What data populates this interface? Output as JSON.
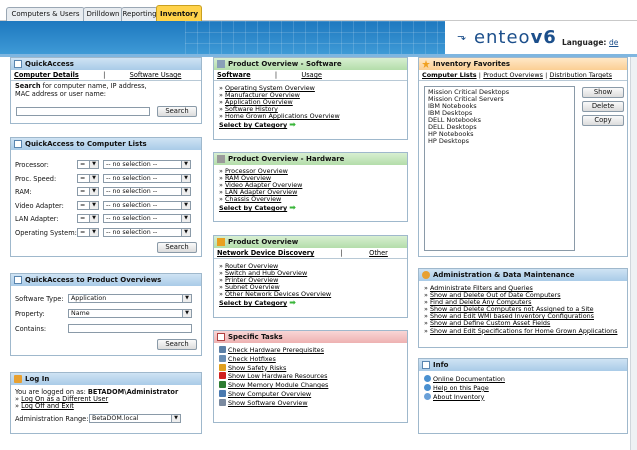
{
  "tabs": [
    {
      "label": "Computers & Users",
      "active": false
    },
    {
      "label": "Drilldown",
      "active": false
    },
    {
      "label": "Reporting",
      "active": false
    },
    {
      "label": "Inventory",
      "active": true
    }
  ],
  "header": {
    "logo_text": "enteo",
    "logo_version": "v6",
    "language_label": "Language:",
    "language_value": "de"
  },
  "quick_access": {
    "title": "QuickAccess",
    "tab_computer_details": "Computer Details",
    "separator": "|",
    "tab_software_usage": "Software Usage",
    "search_bold": "Search",
    "search_text": " for computer name, IP address,",
    "search_text2": "MAC address or user name:",
    "search_value": "",
    "search_button": "Search"
  },
  "qa_computer_lists": {
    "title": "QuickAccess to Computer Lists",
    "rows": [
      {
        "label": "Processor:",
        "op": "=",
        "value": "-- no selection --"
      },
      {
        "label": "Proc. Speed:",
        "op": "=",
        "value": "-- no selection --"
      },
      {
        "label": "RAM:",
        "op": "=",
        "value": "-- no selection --"
      },
      {
        "label": "Video Adapter:",
        "op": "=",
        "value": "-- no selection --"
      },
      {
        "label": "LAN Adapter:",
        "op": "=",
        "value": "-- no selection --"
      },
      {
        "label": "Operating System:",
        "op": "=",
        "value": "-- no selection --"
      }
    ],
    "search_button": "Search"
  },
  "qa_product_overviews": {
    "title": "QuickAccess to Product Overviews",
    "software_type_label": "Software Type:",
    "software_type_value": "Application",
    "property_label": "Property:",
    "property_value": "Name",
    "contains_label": "Contains:",
    "contains_value": "",
    "search_button": "Search"
  },
  "login": {
    "title": "Log In",
    "logged_on_text": "You are logged on as: ",
    "logged_on_user": "BETADOM\\Administrator",
    "link1": "Log On as a Different User",
    "link2": "Log Off and Exit",
    "admin_range_label": "Administration Range:",
    "admin_range_value": "BetaDOM.local"
  },
  "po_software": {
    "title": "Product Overview - Software",
    "tab1": "Software",
    "separator": "|",
    "tab2": "Usage",
    "links": [
      "Operating System Overview",
      "Manufacturer Overview",
      "Application Overview",
      "Software History",
      "Home Grown Applications Overview"
    ],
    "select_category": "Select by Category"
  },
  "po_hardware": {
    "title": "Product Overview - Hardware",
    "links": [
      "Processor Overview",
      "RAM Overview",
      "Video Adapter Overview",
      "LAN Adapter Overview",
      "Chassis Overview"
    ],
    "select_category": "Select by Category"
  },
  "product_overview": {
    "title": "Product Overview",
    "tab1": "Network Device Discovery",
    "separator": "|",
    "tab2": "Other",
    "links": [
      "Router Overview",
      "Switch and Hub Overview",
      "Printer Overview",
      "Subnet Overview",
      "Other Network Devices Overview"
    ],
    "select_category": "Select by Category"
  },
  "specific_tasks": {
    "title": "Specific Tasks",
    "items": [
      {
        "label": "Check Hardware Prerequisites",
        "icon": "hardware-icon",
        "color": "#5b7fa6"
      },
      {
        "label": "Check Hotfixes",
        "icon": "hotfix-icon",
        "color": "#6b8fb5"
      },
      {
        "label": "Show Safety Risks",
        "icon": "warning-icon",
        "color": "#e0a020"
      },
      {
        "label": "Show Low Hardware Resources",
        "icon": "stop-icon",
        "color": "#d02020"
      },
      {
        "label": "Show Memory Module Changes",
        "icon": "memory-icon",
        "color": "#2e7d32"
      },
      {
        "label": "Show Computer Overview",
        "icon": "computer-icon",
        "color": "#4a7ab0"
      },
      {
        "label": "Show Software Overview",
        "icon": "software-icon",
        "color": "#7a8aa0"
      }
    ]
  },
  "inventory_favorites": {
    "title": "Inventory Favorites",
    "tab1": "Computer Lists",
    "sep": "|",
    "tab2": "Product Overviews",
    "tab3": "Distribution Targets",
    "items": [
      "Mission Critical Desktops",
      "Mission Critical Servers",
      "IBM Notebooks",
      "IBM Desktops",
      "DELL Notebooks",
      "DELL Desktops",
      "HP Notebooks",
      "HP Desktops"
    ],
    "show_button": "Show",
    "delete_button": "Delete",
    "copy_button": "Copy"
  },
  "admin": {
    "title": "Administration & Data Maintenance",
    "links": [
      "Administrate Filters and Queries",
      "Show and Delete Out of Date Computers",
      "Find and Delete Any Computers",
      "Show and Delete Computers not Assigned to a Site",
      "Show and Edit WMI based Inventory Configurations",
      "Show and Define Custom Asset Fields",
      "Show and Edit Specifications for Home Grown Applications"
    ]
  },
  "info": {
    "title": "Info",
    "links": [
      "Online Documentation",
      "Help on this Page",
      "About Inventory"
    ]
  },
  "colors": {
    "banner": "#2a86c8",
    "active_tab": "#ffd24a",
    "arrow": "#3ab53a"
  }
}
